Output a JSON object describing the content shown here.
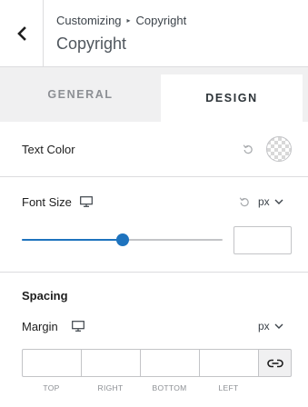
{
  "header": {
    "breadcrumb_parent": "Customizing",
    "breadcrumb_current": "Copyright",
    "title": "Copyright",
    "back_icon": "chevron-left-icon"
  },
  "tabs": [
    {
      "label": "GENERAL",
      "active": false
    },
    {
      "label": "DESIGN",
      "active": true
    }
  ],
  "text_color": {
    "label": "Text Color",
    "reset_icon": "undo-icon",
    "swatch": "transparent"
  },
  "font_size": {
    "label": "Font Size",
    "device_icon": "desktop-icon",
    "reset_icon": "undo-icon",
    "unit": "px",
    "slider_value_fraction": 0.5,
    "value": ""
  },
  "spacing": {
    "heading": "Spacing",
    "margin_label": "Margin",
    "device_icon": "desktop-icon",
    "unit": "px",
    "fields": {
      "top": {
        "label": "TOP",
        "value": ""
      },
      "right": {
        "label": "RIGHT",
        "value": ""
      },
      "bottom": {
        "label": "BOTTOM",
        "value": ""
      },
      "left": {
        "label": "LEFT",
        "value": ""
      }
    },
    "link_icon": "link-icon"
  },
  "colors": {
    "accent": "#1e73be",
    "border": "#dcdcde",
    "tab_bg": "#f0f0f1"
  }
}
